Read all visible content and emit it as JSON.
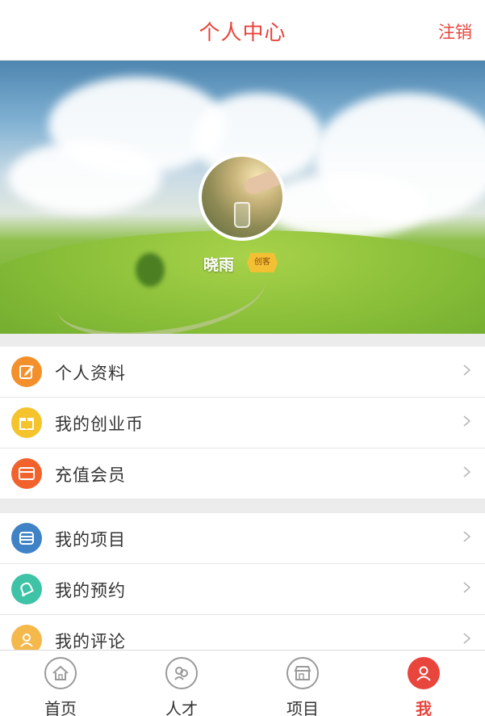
{
  "header": {
    "title": "个人中心",
    "logout_label": "注销"
  },
  "profile": {
    "name": "晓雨",
    "badge": "创客"
  },
  "menu_group1": [
    {
      "label": "个人资料",
      "icon": "edit-icon",
      "color": "#f3902c"
    },
    {
      "label": "我的创业币",
      "icon": "gift-icon",
      "color": "#f5c32c"
    },
    {
      "label": "充值会员",
      "icon": "card-icon",
      "color": "#f2622c"
    }
  ],
  "menu_group2": [
    {
      "label": "我的项目",
      "icon": "stack-icon",
      "color": "#3f82c6"
    },
    {
      "label": "我的预约",
      "icon": "bell-icon",
      "color": "#3ec3a6"
    },
    {
      "label": "我的评论",
      "icon": "user-icon",
      "color": "#f5b84a"
    }
  ],
  "tabbar": [
    {
      "label": "首页",
      "icon": "home-icon"
    },
    {
      "label": "人才",
      "icon": "people-icon"
    },
    {
      "label": "项目",
      "icon": "store-icon"
    },
    {
      "label": "我",
      "icon": "me-icon",
      "active": true
    }
  ],
  "colors": {
    "accent": "#e8453c"
  }
}
